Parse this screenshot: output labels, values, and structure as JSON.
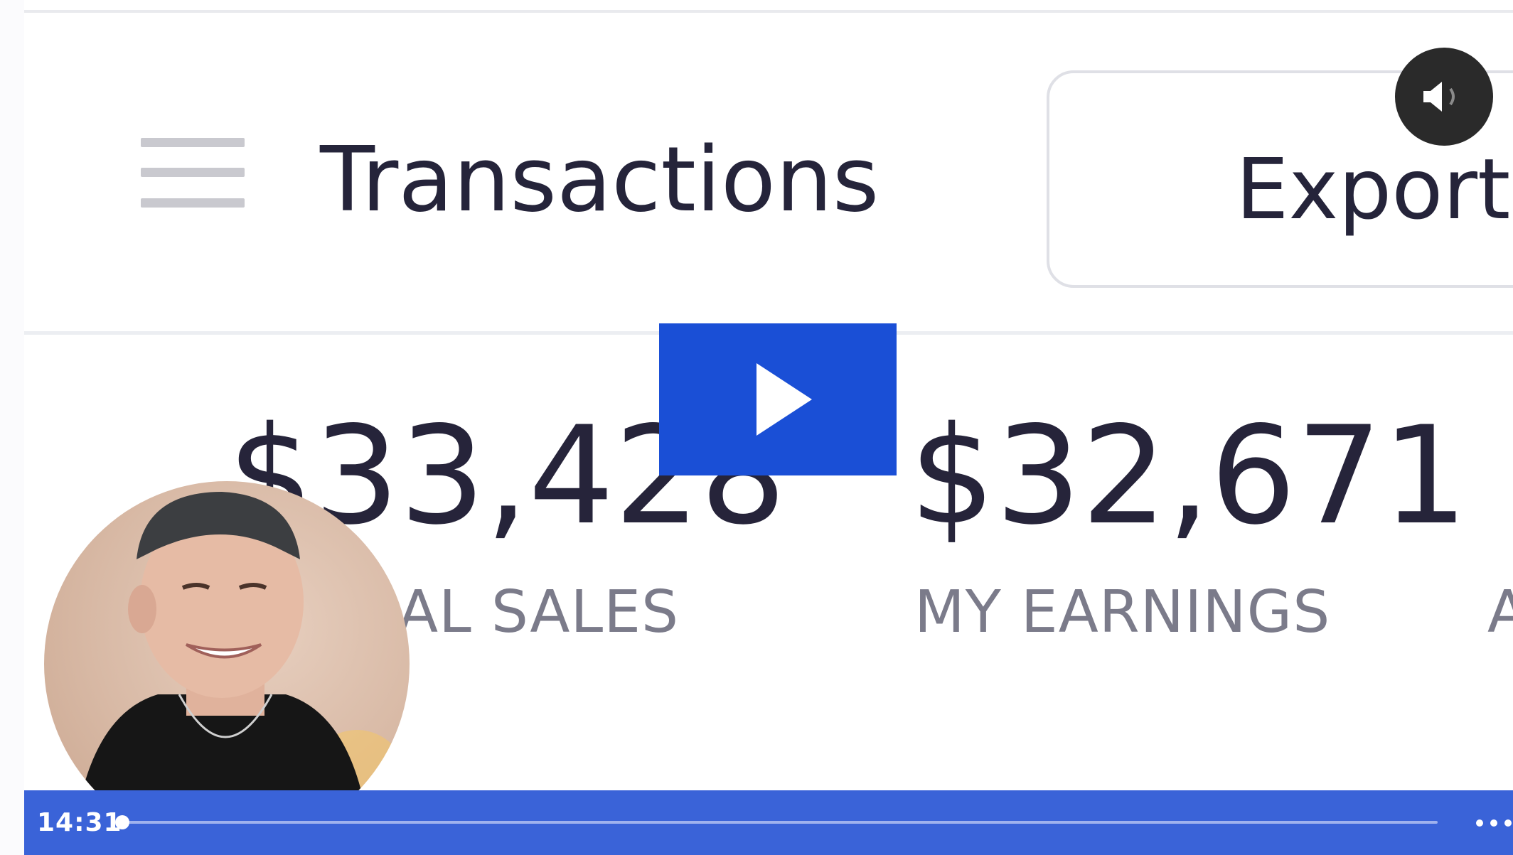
{
  "header": {
    "menu_icon": "hamburger-menu-icon",
    "title": "Transactions",
    "export_label": "Export C"
  },
  "stats": [
    {
      "value": "$33,428",
      "label": "AL SALES"
    },
    {
      "value": "$32,671",
      "label": "MY EARNINGS"
    },
    {
      "value": "",
      "label": "A"
    }
  ],
  "video": {
    "play_icon": "play-icon",
    "mute_icon": "speaker-icon",
    "timestamp": "14:31",
    "progress": 0.0,
    "more_icon": "more-dots-icon"
  },
  "colors": {
    "play_blue": "#1a4fd6",
    "control_blue": "#3a63d8",
    "text_dark": "#25243a",
    "text_muted": "#7b7b8a"
  }
}
